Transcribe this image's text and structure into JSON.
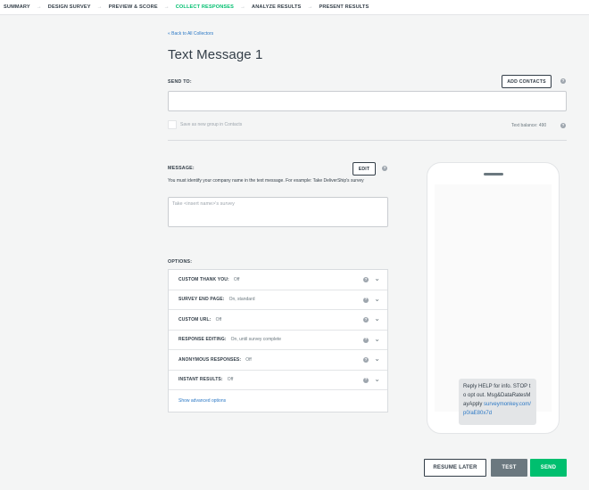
{
  "nav": {
    "steps": [
      "SUMMARY",
      "DESIGN SURVEY",
      "PREVIEW & SCORE",
      "COLLECT RESPONSES",
      "ANALYZE RESULTS",
      "PRESENT RESULTS"
    ],
    "active_index": 3,
    "separator": "→"
  },
  "header": {
    "back_link": "« Back to All Collectors",
    "title": "Text Message 1"
  },
  "send_to": {
    "label": "SEND TO:",
    "add_contacts": "ADD CONTACTS",
    "input_value": "",
    "save_group_label": "Save as new group in Contacts",
    "text_balance": "Text balance: 490"
  },
  "message": {
    "label": "MESSAGE:",
    "edit": "EDIT",
    "hint": "You must identify your company name in the text message. For example: Take DeliverShip's survey",
    "placeholder": "Take <insert name>'s survey"
  },
  "options": {
    "label": "OPTIONS:",
    "rows": [
      {
        "name": "CUSTOM THANK YOU:",
        "value": "Off"
      },
      {
        "name": "SURVEY END PAGE:",
        "value": "On, standard"
      },
      {
        "name": "CUSTOM URL:",
        "value": "Off"
      },
      {
        "name": "RESPONSE EDITING:",
        "value": "On, until survey complete"
      },
      {
        "name": "ANONYMOUS RESPONSES:",
        "value": "Off"
      },
      {
        "name": "INSTANT RESULTS:",
        "value": "Off"
      }
    ],
    "advanced": "Show advanced options"
  },
  "preview": {
    "text": "Reply HELP for info. STOP to opt out. Msg&DataRatesMayApply",
    "link": "surveymonkey.com/p0/aE80x7d"
  },
  "actions": {
    "resume": "RESUME LATER",
    "test": "TEST",
    "send": "SEND"
  },
  "colors": {
    "accent_green": "#00bf6f",
    "link_blue": "#2b78c5",
    "dark_text": "#333e48",
    "test_button": "#6b787f"
  },
  "icons": {
    "help": "help-icon",
    "chevron": "chevron-down-icon"
  }
}
